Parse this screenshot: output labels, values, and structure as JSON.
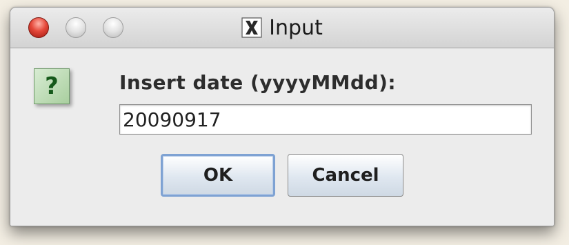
{
  "window": {
    "title": "Input"
  },
  "dialog": {
    "icon_glyph": "?",
    "prompt": "Insert date (yyyyMMdd):",
    "date_value": "20090917",
    "ok_label": "OK",
    "cancel_label": "Cancel"
  },
  "icons": {
    "close": "close-traffic-light-icon",
    "minimize": "minimize-traffic-light-icon",
    "zoom": "zoom-traffic-light-icon",
    "app": "x-window-icon",
    "question": "question-icon"
  },
  "colors": {
    "close_button": "#e5483a",
    "question_icon_bg": "#b8d8ae",
    "question_glyph": "#15591a",
    "default_button_border": "#7ea2d3",
    "window_bg": "#ececec"
  }
}
